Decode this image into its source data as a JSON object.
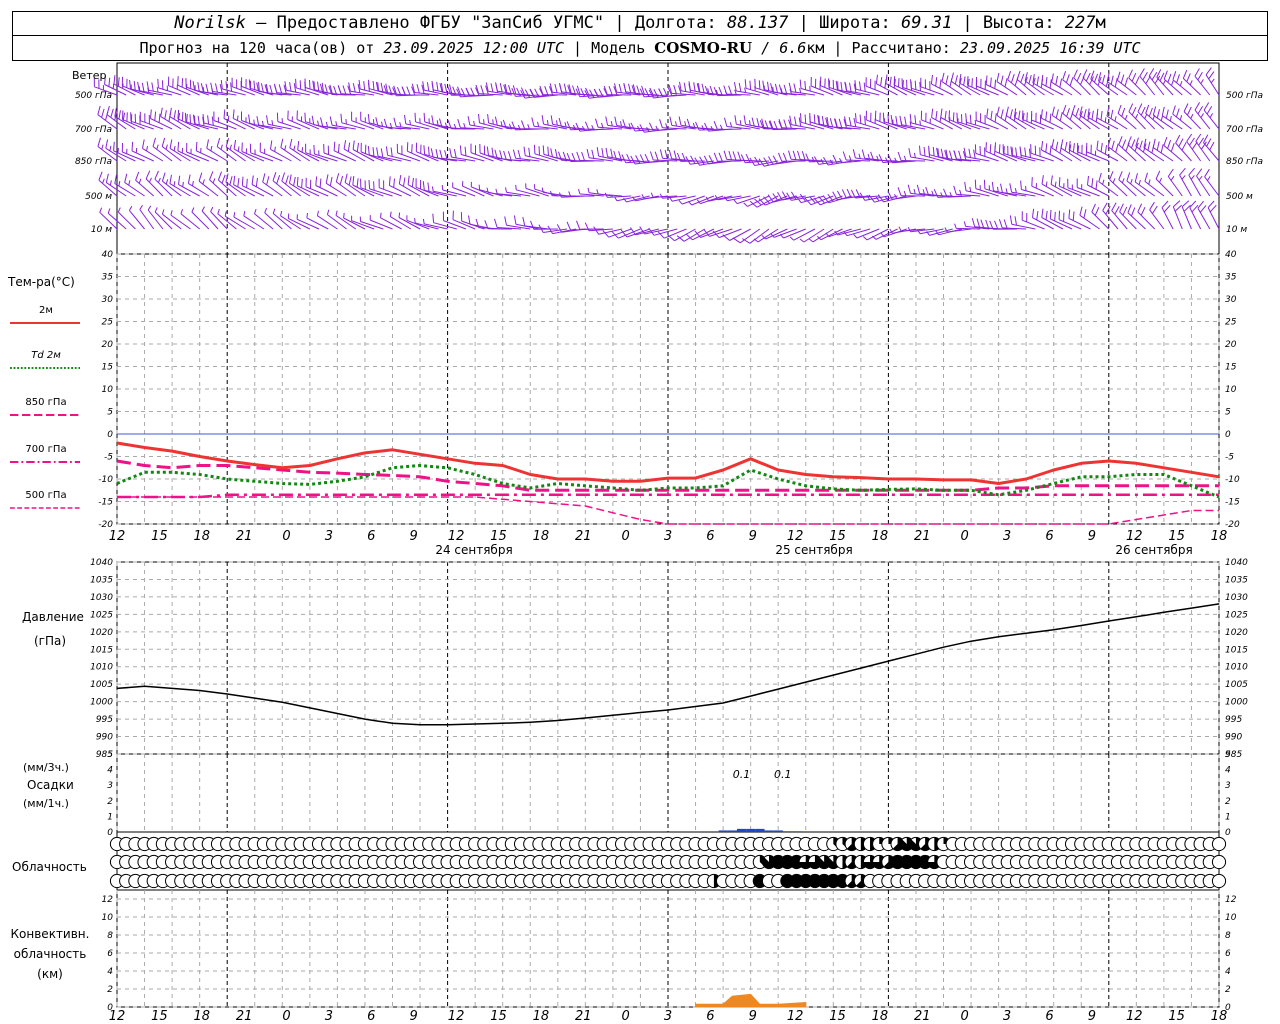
{
  "header": {
    "station": "Norilsk",
    "dash": " – ",
    "provider": "Предоставлено ФГБУ \"ЗапСиб УГМС\"",
    "sep": " | ",
    "lon_label": "Долгота: ",
    "lon_value": "88.137",
    "lat_label": "Широта: ",
    "lat_value": "69.31",
    "alt_label": "Высота: ",
    "alt_value": "227",
    "alt_unit": "м",
    "forecast_label": "Прогноз на 120 часа(ов) от ",
    "forecast_start": "23.09.2025 12:00 UTC",
    "model_label": " | Модель ",
    "model_name": "COSMO-RU",
    "model_res_sep": " / ",
    "model_res": "6.6",
    "model_res_unit": "км",
    "calc_label": " | Рассчитано: ",
    "calc_time": "23.09.2025 16:39 UTC"
  },
  "labels": {
    "wind_title": "Ветер",
    "wind_levels": [
      "500 гПа",
      "700 гПа",
      "850 гПа",
      "500 м",
      "10  м"
    ],
    "temp_title": "Тем-ра(°С)",
    "temp_legend": [
      "2м",
      "Td  2м",
      "850 гПа",
      "700 гПа",
      "500 гПа"
    ],
    "pressure_title": "Давление",
    "pressure_unit": "(гПа)",
    "precip_unit3": "(мм/3ч.)",
    "precip_title": "Осадки",
    "precip_unit1": "(мм/1ч.)",
    "cloud_title": "Облачность",
    "conv_title": [
      "Конвективн.",
      "облачность",
      "(км)"
    ],
    "day_labels": [
      "24 сентября",
      "25 сентября",
      "26 сентября"
    ],
    "precip_values": [
      "0.1",
      "0.1"
    ]
  },
  "colors": {
    "t2m": "#ee3333",
    "td2m": "#118811",
    "t850": "#ee1188",
    "t700": "#ee1188",
    "t500": "#ee1188",
    "wind": "#8822dd",
    "pressure": "#000000",
    "precip": "#2244cc",
    "convective": "#ee8822",
    "zero_line": "#4455dd"
  },
  "chart_data": [
    {
      "type": "line",
      "name": "temperature",
      "x_hours": [
        0,
        3,
        6,
        9,
        12,
        15,
        18,
        21,
        24,
        27,
        30,
        33,
        36,
        39,
        42,
        45,
        48,
        51,
        54,
        57,
        60,
        63,
        66,
        69,
        72,
        75,
        78,
        81,
        84,
        87,
        90,
        93,
        96,
        99,
        102,
        105,
        108,
        111,
        114,
        117,
        120
      ],
      "ylim": [
        -20,
        40
      ],
      "y_ticks": [
        -20,
        -15,
        -10,
        -5,
        0,
        5,
        10,
        15,
        20,
        25,
        30,
        35,
        40
      ],
      "series": [
        {
          "name": "2м",
          "values": [
            -2,
            -3,
            -3.8,
            -5,
            -6,
            -6.8,
            -7.5,
            -7,
            -5.5,
            -4.2,
            -3.5,
            -4.5,
            -5.5,
            -6.5,
            -7,
            -9,
            -10,
            -10,
            -10.5,
            -10.5,
            -9.8,
            -9.8,
            -8,
            -5.5,
            -8,
            -9,
            -9.5,
            -9.7,
            -10,
            -10,
            -10.2,
            -10.2,
            -11,
            -10,
            -8,
            -6.5,
            -6,
            -6.5,
            -7.5,
            -8.5,
            -9.5
          ]
        },
        {
          "name": "Td  2м",
          "values": [
            -11,
            -8.5,
            -8.5,
            -9,
            -10,
            -10.5,
            -11,
            -11.2,
            -10.5,
            -9.5,
            -7.5,
            -7,
            -7.5,
            -9,
            -11,
            -12,
            -11,
            -11.5,
            -12,
            -12.5,
            -12,
            -12,
            -11.5,
            -8,
            -10,
            -11.5,
            -12.2,
            -12.5,
            -12.3,
            -12.2,
            -12.5,
            -12.5,
            -13.5,
            -12.5,
            -11,
            -9.5,
            -9.5,
            -9,
            -9,
            -11.5,
            -14
          ]
        },
        {
          "name": "850 гПа",
          "values": [
            -6,
            -7,
            -7.5,
            -7,
            -7,
            -7.5,
            -8,
            -8.5,
            -8.7,
            -9,
            -9.2,
            -9.5,
            -10.5,
            -11,
            -11.5,
            -12.5,
            -12.5,
            -12.5,
            -12.5,
            -12.5,
            -12.5,
            -12.5,
            -12.5,
            -12.5,
            -12.5,
            -12.5,
            -12.5,
            -12.5,
            -12.5,
            -12.5,
            -12.5,
            -12.5,
            -12,
            -12,
            -11.5,
            -11.5,
            -11.5,
            -11.5,
            -11.5,
            -11.5,
            -11.5
          ]
        },
        {
          "name": "700 гПа",
          "values": [
            -14,
            -14,
            -14,
            -14,
            -13.5,
            -13.5,
            -13.5,
            -13.5,
            -13.5,
            -13.5,
            -13.5,
            -13.5,
            -13.5,
            -13.5,
            -13.5,
            -13.5,
            -13.5,
            -13.5,
            -13.5,
            -13.5,
            -13.5,
            -13.5,
            -13.5,
            -13.5,
            -13.5,
            -13.5,
            -13.5,
            -13.5,
            -13.5,
            -13.5,
            -13.5,
            -13.5,
            -13.5,
            -13.5,
            -13.5,
            -13.5,
            -13.5,
            -13.5,
            -13.5,
            -13.5,
            -13.5
          ]
        },
        {
          "name": "500 гПа",
          "values": [
            -14,
            -14,
            -14,
            -14,
            -14,
            -14,
            -14,
            -14,
            -14,
            -14,
            -14,
            -14,
            -14,
            -14,
            -14.5,
            -15,
            -15.5,
            -16,
            -17.5,
            -19,
            -20,
            -20,
            -20,
            -20,
            -20,
            -20,
            -20,
            -20,
            -20,
            -20,
            -20,
            -20,
            -20,
            -20,
            -20,
            -20,
            -20,
            -19,
            -18,
            -17,
            -17
          ]
        }
      ]
    },
    {
      "type": "line",
      "name": "pressure",
      "x_hours": [
        0,
        3,
        6,
        9,
        12,
        15,
        18,
        21,
        24,
        27,
        30,
        33,
        36,
        39,
        42,
        45,
        48,
        51,
        54,
        57,
        60,
        63,
        66,
        69,
        72,
        75,
        78,
        81,
        84,
        87,
        90,
        93,
        96,
        99,
        102,
        105,
        108,
        111,
        114,
        117,
        120
      ],
      "ylim": [
        985,
        1040
      ],
      "y_ticks": [
        985,
        990,
        995,
        1000,
        1005,
        1010,
        1015,
        1020,
        1025,
        1030,
        1035,
        1040
      ],
      "values": [
        1003.8,
        1004.4,
        1003.8,
        1003.2,
        1002.2,
        1001,
        999.8,
        998.2,
        996.6,
        995,
        993.8,
        993.4,
        993.4,
        993.6,
        993.8,
        994.1,
        994.6,
        995.3,
        996.1,
        996.9,
        997.6,
        998.6,
        999.6,
        1001.6,
        1003.6,
        1005.6,
        1007.6,
        1009.6,
        1011.6,
        1013.6,
        1015.6,
        1017.3,
        1018.6,
        1019.6,
        1020.6,
        1021.8,
        1023.1,
        1024.3,
        1025.6,
        1026.8,
        1028
      ]
    },
    {
      "type": "bar",
      "name": "precipitation",
      "x_hours": [
        66,
        67,
        68,
        69,
        70,
        71,
        72,
        73,
        74
      ],
      "ylim": [
        0,
        5
      ],
      "values": [
        0.1,
        0.1,
        0.2,
        0.2,
        0.2,
        0.1,
        0.1,
        0.05,
        0.05
      ]
    },
    {
      "type": "area",
      "name": "convective_cloud",
      "x_hours": [
        63,
        66,
        67,
        69,
        70,
        72,
        75
      ],
      "ylim": [
        0,
        13
      ],
      "y_ticks": [
        0,
        2,
        4,
        6,
        8,
        10,
        12
      ],
      "values": [
        0.3,
        0.3,
        1.2,
        1.4,
        0.3,
        0.3,
        0.5
      ]
    },
    {
      "type": "table",
      "name": "cloudiness",
      "cover_scale": "0=clear, 8=overcast (eighths)",
      "rows": [
        {
          "level": "high",
          "values": [
            0,
            0,
            0,
            0,
            0,
            0,
            0,
            0,
            0,
            0,
            0,
            0,
            0,
            0,
            0,
            0,
            0,
            0,
            0,
            0,
            0,
            0,
            0,
            0,
            0,
            0,
            0,
            0,
            0,
            0,
            0,
            0,
            0,
            0,
            0,
            0,
            0,
            0,
            0,
            0,
            0,
            0,
            0,
            0,
            0,
            0,
            0,
            0,
            0,
            0,
            0,
            0,
            0,
            0,
            0,
            0,
            0,
            0,
            0,
            0,
            0,
            0,
            0,
            0,
            0,
            0,
            0,
            0,
            0,
            0,
            0,
            0,
            0,
            0,
            0,
            0,
            0,
            0,
            3,
            3,
            5,
            4,
            4,
            2,
            2,
            5,
            7,
            7,
            5,
            4,
            2,
            0,
            0,
            0,
            0,
            0,
            0,
            0,
            0,
            0,
            0,
            0,
            0,
            0,
            0,
            0,
            0,
            0,
            0,
            0,
            0,
            0,
            0,
            0,
            0,
            0,
            0,
            0,
            0,
            0,
            0
          ]
        },
        {
          "level": "middle",
          "values": [
            0,
            0,
            0,
            0,
            0,
            0,
            0,
            0,
            0,
            0,
            0,
            0,
            0,
            0,
            0,
            0,
            0,
            0,
            0,
            0,
            0,
            0,
            0,
            0,
            0,
            0,
            0,
            0,
            0,
            0,
            0,
            0,
            0,
            0,
            0,
            0,
            0,
            0,
            0,
            0,
            0,
            0,
            0,
            0,
            0,
            0,
            0,
            0,
            0,
            0,
            0,
            0,
            0,
            0,
            0,
            0,
            0,
            0,
            0,
            0,
            0,
            0,
            0,
            0,
            0,
            0,
            0,
            0,
            0,
            0,
            3,
            7,
            8,
            8,
            8,
            6,
            6,
            7,
            7,
            4,
            5,
            4,
            6,
            6,
            5,
            8,
            8,
            8,
            8,
            6,
            0,
            0,
            0,
            0,
            0,
            0,
            0,
            0,
            0,
            0,
            0,
            0,
            0,
            0,
            0,
            0,
            0,
            0,
            0,
            0,
            0,
            0,
            0,
            0,
            0,
            0,
            0,
            0,
            0,
            0,
            0
          ]
        },
        {
          "level": "low",
          "values": [
            0,
            0,
            0,
            0,
            0,
            0,
            0,
            0,
            0,
            0,
            0,
            0,
            0,
            0,
            0,
            0,
            0,
            0,
            0,
            0,
            0,
            0,
            0,
            0,
            0,
            0,
            0,
            0,
            0,
            0,
            0,
            0,
            0,
            0,
            0,
            0,
            0,
            0,
            0,
            0,
            0,
            0,
            0,
            0,
            0,
            0,
            0,
            0,
            0,
            0,
            0,
            0,
            0,
            0,
            0,
            0,
            0,
            0,
            0,
            0,
            0,
            0,
            0,
            0,
            0,
            4,
            0,
            0,
            0,
            0,
            8,
            0,
            0,
            8,
            8,
            8,
            8,
            8,
            8,
            8,
            5,
            5,
            0,
            0,
            0,
            0,
            0,
            0,
            0,
            0,
            0,
            0,
            0,
            0,
            0,
            0,
            0,
            0,
            0,
            0,
            0,
            0,
            0,
            0,
            0,
            0,
            0,
            0,
            0,
            0,
            0,
            0,
            0,
            0,
            0,
            0,
            0,
            0,
            0,
            0,
            0
          ]
        }
      ]
    },
    {
      "type": "scatter",
      "name": "wind",
      "levels": [
        "500 гПа",
        "700 гПа",
        "850 гПа",
        "500 м",
        "10  м"
      ],
      "note": "wind barbs every hour; direction in degrees (from), speed in m/s",
      "x_hours": [
        0,
        12,
        24,
        36,
        48,
        60,
        72,
        84,
        96,
        108,
        120
      ],
      "series": [
        {
          "name": "500 гПа",
          "dir": [
            290,
            285,
            280,
            275,
            270,
            270,
            280,
            290,
            300,
            310,
            320
          ],
          "speed": [
            12,
            12,
            11,
            10,
            10,
            11,
            13,
            15,
            16,
            15,
            13
          ]
        },
        {
          "name": "700 гПа",
          "dir": [
            300,
            290,
            285,
            280,
            275,
            270,
            275,
            285,
            295,
            305,
            315
          ],
          "speed": [
            10,
            10,
            9,
            8,
            8,
            8,
            10,
            12,
            14,
            14,
            12
          ]
        },
        {
          "name": "850 гПа",
          "dir": [
            300,
            300,
            295,
            285,
            280,
            270,
            265,
            270,
            285,
            300,
            320
          ],
          "speed": [
            9,
            9,
            8,
            7,
            6,
            6,
            7,
            9,
            11,
            12,
            10
          ]
        },
        {
          "name": "500 м",
          "dir": [
            310,
            305,
            300,
            290,
            280,
            260,
            250,
            260,
            280,
            300,
            330
          ],
          "speed": [
            8,
            8,
            7,
            6,
            5,
            5,
            6,
            8,
            9,
            10,
            9
          ]
        },
        {
          "name": "10  м",
          "dir": [
            320,
            310,
            300,
            290,
            270,
            250,
            240,
            250,
            270,
            310,
            340
          ],
          "speed": [
            5,
            5,
            4,
            4,
            3,
            3,
            4,
            5,
            6,
            7,
            6
          ]
        }
      ]
    }
  ],
  "time_axis": {
    "tick_labels": [
      "12",
      "15",
      "18",
      "21",
      "0",
      "3",
      "6",
      "9",
      "12",
      "15",
      "18",
      "21",
      "0",
      "3",
      "6",
      "9",
      "12",
      "15",
      "18",
      "21",
      "0",
      "3",
      "6",
      "9",
      "12",
      "15",
      "18"
    ]
  }
}
